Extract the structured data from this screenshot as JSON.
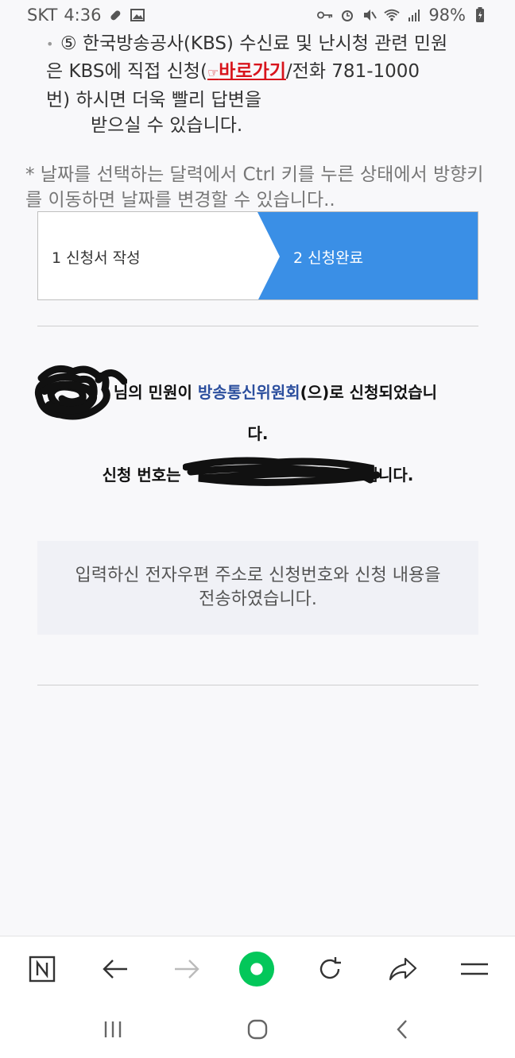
{
  "status_bar": {
    "carrier": "SKT",
    "time": "4:36",
    "battery": "98%"
  },
  "notice": {
    "bullet": "•",
    "line1": "⑤ 한국방송공사(KBS) 수신료 및 난시청 관련 민원",
    "line2_prefix": "은 KBS에 직접 신청(",
    "link_hand": "☞",
    "link_text": "바로가기",
    "line2_suffix": "/전화 781-1000",
    "line3": "번) 하시면 더욱 빨리 답변을",
    "line4": "받으실 수 있습니다."
  },
  "hint": "* 날짜를 선택하는 달력에서 Ctrl 키를 누른 상태에서 방향키를 이동하면 날짜를 변경할 수 있습니다..",
  "steps": {
    "step1": "1 신청서 작성",
    "step2": "2 신청완료",
    "active_color": "#3a8fe6"
  },
  "result": {
    "line1_prefix": "님의 민원이 ",
    "org": "방송통신위원회",
    "line1_suffix": "(으)로 신청되었습니",
    "line1_wrap": "다.",
    "line2_prefix": "신청 번호는",
    "line2_suffix": "입니다."
  },
  "mail_notice": "입력하신 전자우편 주소로 신청번호와 신청 내용을 전송하였습니다.",
  "toolbar": {
    "icons": [
      "naver-home-icon",
      "back-arrow-icon",
      "forward-arrow-icon",
      "green-dot-icon",
      "reload-icon",
      "share-icon",
      "menu-icon"
    ],
    "accent": "#03c75a"
  },
  "navbar": {
    "icons": [
      "recent-apps-icon",
      "home-icon",
      "back-icon"
    ]
  }
}
